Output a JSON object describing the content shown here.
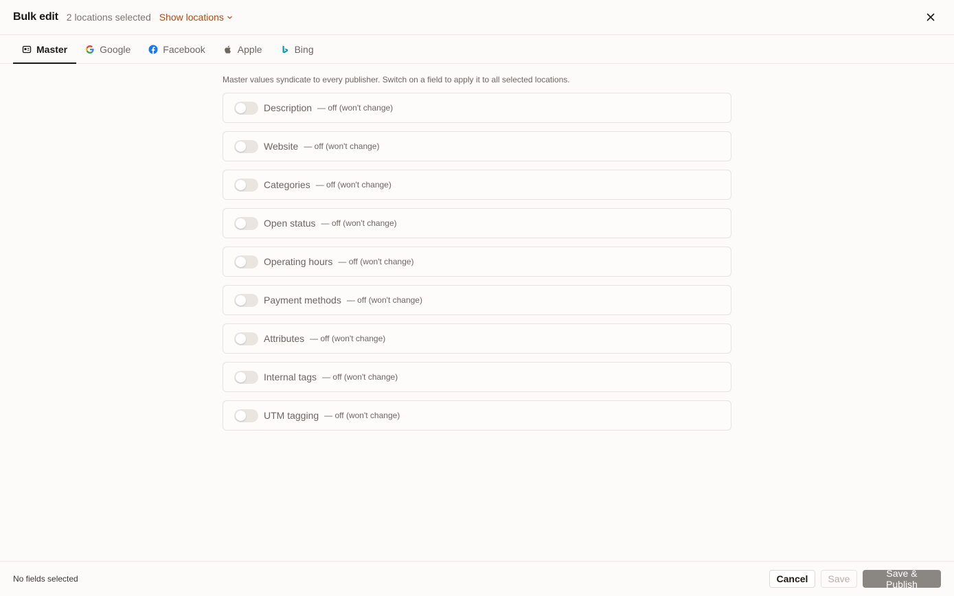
{
  "header": {
    "title": "Bulk edit",
    "selection_summary": "2 locations selected",
    "show_locations_label": "Show locations",
    "close_icon": "close-icon"
  },
  "tabs": [
    {
      "label": "Master",
      "icon": "id-card-icon",
      "active": true
    },
    {
      "label": "Google",
      "icon": "google-icon",
      "active": false
    },
    {
      "label": "Facebook",
      "icon": "facebook-icon",
      "active": false
    },
    {
      "label": "Apple",
      "icon": "apple-icon",
      "active": false
    },
    {
      "label": "Bing",
      "icon": "bing-icon",
      "active": false
    }
  ],
  "intro": "Master values syndicate to every publisher. Switch on a field to apply it to all selected locations.",
  "fields": [
    {
      "label": "Description",
      "status": "— off (won't change)",
      "enabled": false
    },
    {
      "label": "Website",
      "status": "— off (won't change)",
      "enabled": false
    },
    {
      "label": "Categories",
      "status": "— off (won't change)",
      "enabled": false
    },
    {
      "label": "Open status",
      "status": "— off (won't change)",
      "enabled": false
    },
    {
      "label": "Operating hours",
      "status": "— off (won't change)",
      "enabled": false
    },
    {
      "label": "Payment methods",
      "status": "— off (won't change)",
      "enabled": false
    },
    {
      "label": "Attributes",
      "status": "— off (won't change)",
      "enabled": false
    },
    {
      "label": "Internal tags",
      "status": "— off (won't change)",
      "enabled": false
    },
    {
      "label": "UTM tagging",
      "status": "— off (won't change)",
      "enabled": false
    }
  ],
  "footer": {
    "status": "No fields selected",
    "cancel_label": "Cancel",
    "save_label": "Save",
    "publish_label": "Save & Publish"
  },
  "colors": {
    "accent_link": "#b5470b",
    "publish_button": "#8a8782",
    "facebook": "#1877f2",
    "bing": "#0f9bb5"
  }
}
